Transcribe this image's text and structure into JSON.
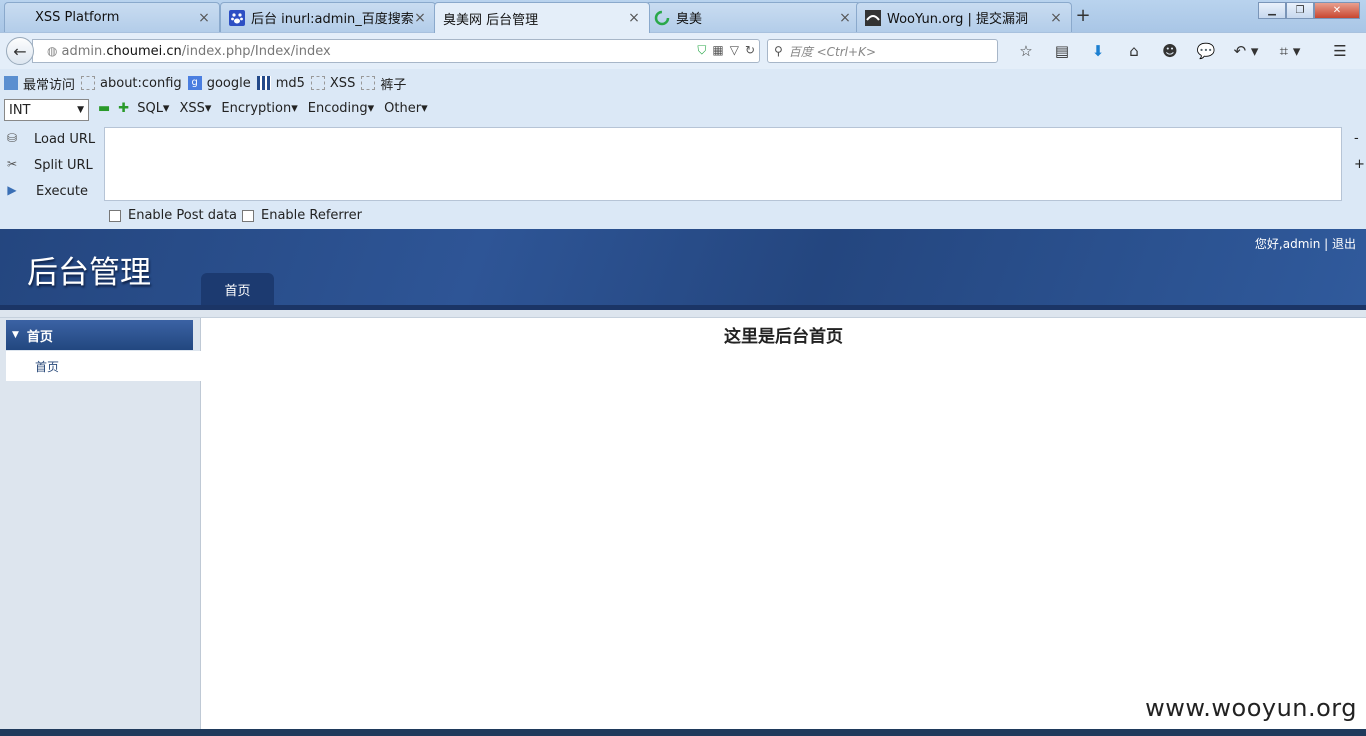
{
  "browser": {
    "tabs": [
      {
        "label": "XSS Platform",
        "icon": "blank-page-icon",
        "active": false
      },
      {
        "label": "后台 inurl:admin_百度搜索",
        "icon": "baidu-paw-icon",
        "active": false
      },
      {
        "label": "臭美网 后台管理",
        "icon": "none",
        "active": true
      },
      {
        "label": "臭美",
        "icon": "loading-spinner-icon",
        "active": false
      },
      {
        "label": "WooYun.org | 提交漏洞",
        "icon": "wooyun-logo-icon",
        "active": false
      }
    ],
    "tab_close_glyph": "×",
    "new_tab_glyph": "+",
    "url": {
      "prefix": "admin.",
      "host": "choumei.cn",
      "path": "/index.php/Index/index"
    },
    "search_placeholder": "百度 <Ctrl+K>"
  },
  "bookmarks": [
    {
      "label": "最常访问",
      "icon": "most-visited-icon"
    },
    {
      "label": "about:config",
      "icon": "blank-page-icon"
    },
    {
      "label": "google",
      "icon": "google-icon"
    },
    {
      "label": "md5",
      "icon": "grid-icon"
    },
    {
      "label": "XSS",
      "icon": "blank-page-icon"
    },
    {
      "label": "裤子",
      "icon": "blank-page-icon"
    }
  ],
  "hackbar": {
    "select_value": "INT",
    "menus": [
      "SQL▾",
      "XSS▾",
      "Encryption▾",
      "Encoding▾",
      "Other▾"
    ],
    "load_url": "Load URL",
    "split_url": "Split URL",
    "execute": "Execute",
    "enable_post": "Enable Post data",
    "enable_referrer": "Enable Referrer",
    "minus": "-",
    "plus": "+"
  },
  "site": {
    "title": "后台管理",
    "user_info": "您好,admin | 退出",
    "nav_home": "首页",
    "sidebar_header": "首页",
    "sidebar_item": "首页",
    "main_heading": "这里是后台首页",
    "watermark": "www.wooyun.org"
  },
  "colors": {
    "header_bg": "#2e5596",
    "accent_tab": "#1c3a70"
  }
}
